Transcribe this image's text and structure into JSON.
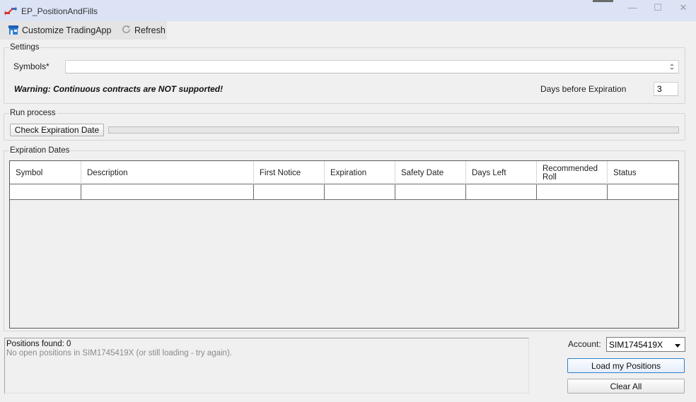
{
  "window": {
    "title": "EP_PositionAndFills",
    "controls": {
      "minimize": "—",
      "maximize": "☐",
      "close": "✕"
    }
  },
  "toolbar": {
    "customize_label": "Customize TradingApp",
    "refresh_label": "Refresh"
  },
  "settings": {
    "group_label": "Settings",
    "symbols_label": "Symbols*",
    "symbols_value": "",
    "warning": "Warning: Continuous contracts are NOT supported!",
    "days_label": "Days before Expiration",
    "days_value": "3"
  },
  "run_process": {
    "group_label": "Run process",
    "check_button": "Check Expiration Date",
    "progress": 0
  },
  "expiration": {
    "group_label": "Expiration Dates",
    "columns": [
      "Symbol",
      "Description",
      "First Notice",
      "Expiration",
      "Safety Date",
      "Days Left",
      "Recommended Roll",
      "Status"
    ]
  },
  "log": {
    "line1": "Positions found: 0",
    "line2": "No open positions in SIM1745419X (or still loading - try again)."
  },
  "account": {
    "label": "Account:",
    "selected": "SIM1745419X"
  },
  "buttons": {
    "load": "Load my Positions",
    "clear": "Clear All"
  },
  "colors": {
    "titlebar": "#dbe3f5",
    "primary_border": "#2f7fd0",
    "app_icon_red": "#d9332b",
    "app_icon_blue": "#2f6fc9"
  }
}
